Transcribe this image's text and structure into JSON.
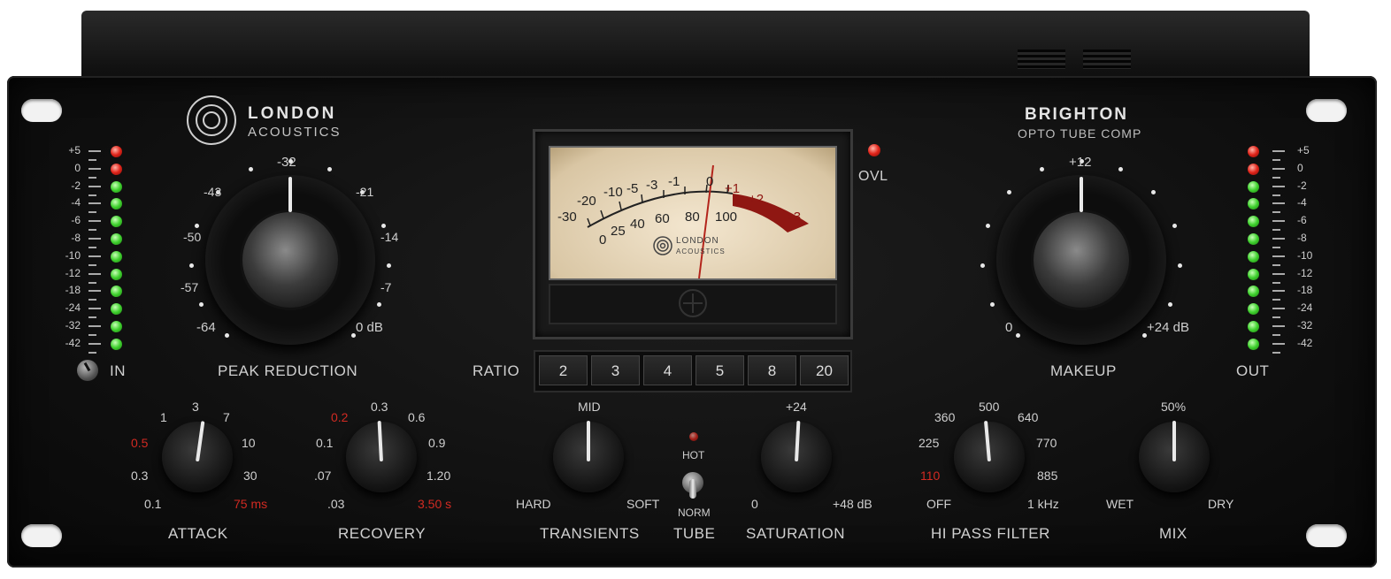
{
  "brand": {
    "line1": "LONDON",
    "line2": "ACOUSTICS"
  },
  "product": {
    "name": "BRIGHTON",
    "subtitle": "OPTO TUBE COMP"
  },
  "ovl": {
    "label": "OVL"
  },
  "meter_scale": [
    "+5",
    "0",
    "-2",
    "-4",
    "-6",
    "-8",
    "-10",
    "-12",
    "-18",
    "-24",
    "-32",
    "-42"
  ],
  "in_meter": {
    "leds": [
      "r",
      "r",
      "g",
      "g",
      "g",
      "g",
      "g",
      "g",
      "g",
      "g",
      "g",
      "g"
    ]
  },
  "out_meter": {
    "leds": [
      "r",
      "r",
      "g",
      "g",
      "g",
      "g",
      "g",
      "g",
      "g",
      "g",
      "g",
      "g"
    ]
  },
  "input": {
    "label": "IN"
  },
  "output": {
    "label": "OUT"
  },
  "peak_reduction": {
    "label": "PEAK REDUCTION",
    "scale": {
      "top": "-32",
      "tl1": "-43",
      "tl2": "-50",
      "tl3": "-57",
      "bl": "-64",
      "tr1": "-21",
      "tr2": "-14",
      "tr3": "-7",
      "br": "0 dB"
    }
  },
  "makeup": {
    "label": "MAKEUP",
    "scale": {
      "top": "+12",
      "bl": "0",
      "br": "+24 dB"
    }
  },
  "vu_meter": {
    "brand1": "LONDON",
    "brand2": "ACOUSTICS",
    "upper_scale": [
      "-30",
      "-20",
      "-10",
      "-5",
      "-3",
      "-1",
      "0",
      "+1",
      "+2",
      "+3"
    ],
    "lower_scale": [
      "0",
      "25",
      "40",
      "60",
      "80",
      "100"
    ]
  },
  "ratio": {
    "label": "RATIO",
    "options": [
      "2",
      "3",
      "4",
      "5",
      "8",
      "20"
    ]
  },
  "attack": {
    "label": "ATTACK",
    "scale": {
      "top": "3",
      "t1": "1",
      "t2": "7",
      "l1": "0.5",
      "l2": "0.3",
      "l3": "0.1",
      "r1": "10",
      "r2": "30",
      "r3": "75 ms"
    }
  },
  "recovery": {
    "label": "RECOVERY",
    "scale": {
      "top": "0.3",
      "t1": "0.2",
      "t2": "0.6",
      "l1": "0.1",
      "l2": ".07",
      "l3": ".03",
      "r1": "0.9",
      "r2": "1.20",
      "r3": "3.50 s"
    }
  },
  "transients": {
    "label": "TRANSIENTS",
    "scale": {
      "top": "MID",
      "l": "HARD",
      "r": "SOFT"
    }
  },
  "tube": {
    "label": "TUBE",
    "hot": "HOT",
    "norm": "NORM"
  },
  "saturation": {
    "label": "SATURATION",
    "scale": {
      "top": "+24",
      "l": "0",
      "r": "+48 dB"
    }
  },
  "hi_pass": {
    "label": "HI PASS FILTER",
    "scale": {
      "top": "500",
      "t1": "360",
      "t2": "640",
      "l1": "225",
      "l2": "110",
      "l3": "OFF",
      "r1": "770",
      "r2": "885",
      "r3": "1 kHz"
    }
  },
  "mix": {
    "label": "MIX",
    "scale": {
      "top": "50%",
      "l": "WET",
      "r": "DRY"
    }
  }
}
